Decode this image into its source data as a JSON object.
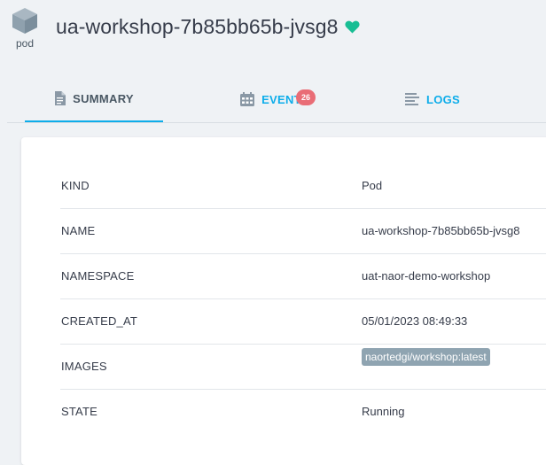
{
  "header": {
    "kind_icon": "cube-icon",
    "kind_label": "pod",
    "title": "ua-workshop-7b85bb65b-jvsg8",
    "health_icon": "heart-icon",
    "health_color": "#18be94"
  },
  "tabs": [
    {
      "label": "SUMMARY",
      "icon": "file-icon",
      "active": true
    },
    {
      "label": "EVENTS",
      "icon": "calendar-icon",
      "badge": "26"
    },
    {
      "label": "LOGS",
      "icon": "lines-icon"
    }
  ],
  "summary": {
    "rows": [
      {
        "key": "KIND",
        "value": "Pod"
      },
      {
        "key": "NAME",
        "value": "ua-workshop-7b85bb65b-jvsg8"
      },
      {
        "key": "NAMESPACE",
        "value": "uat-naor-demo-workshop"
      },
      {
        "key": "CREATED_AT",
        "value": "05/01/2023 08:49:33"
      },
      {
        "key": "IMAGES",
        "value": "naortedgi/workshop:latest"
      },
      {
        "key": "STATE",
        "value": "Running"
      }
    ]
  },
  "colors": {
    "accent": "#0dadea",
    "badge": "#e96d76",
    "tag": "#8fa4b1"
  }
}
